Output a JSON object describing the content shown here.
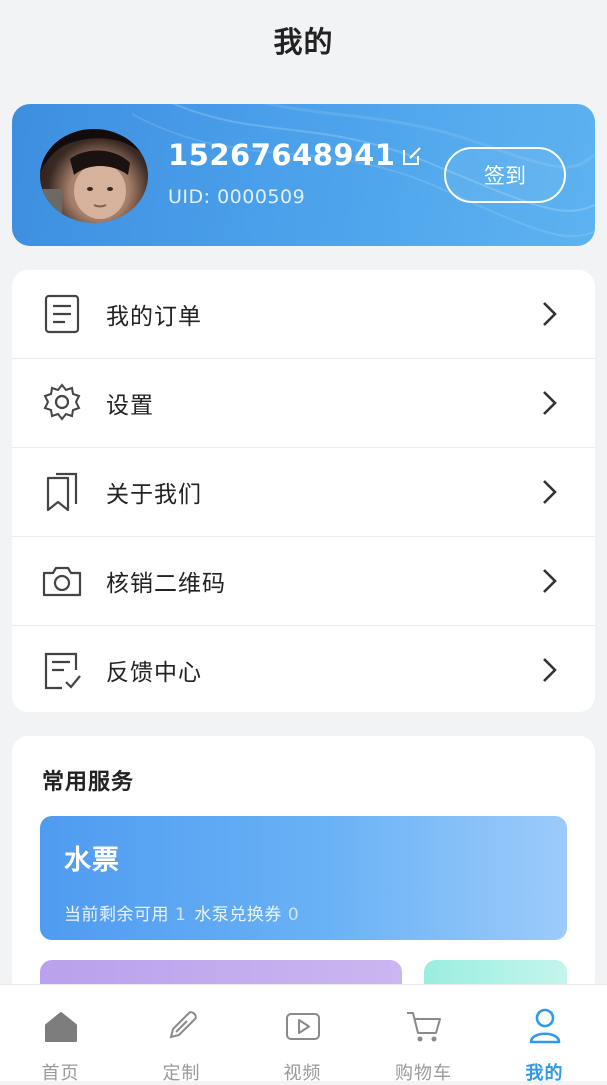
{
  "header": {
    "title": "我的"
  },
  "profile": {
    "phone": "15267648941",
    "uid": "UID: 0000509",
    "signin_label": "签到"
  },
  "menu": {
    "items": [
      {
        "label": "我的订单",
        "icon": "order-list-icon"
      },
      {
        "label": "设置",
        "icon": "gear-icon"
      },
      {
        "label": "关于我们",
        "icon": "bookmark-icon"
      },
      {
        "label": "核销二维码",
        "icon": "camera-icon"
      },
      {
        "label": "反馈中心",
        "icon": "feedback-icon"
      }
    ]
  },
  "services": {
    "title": "常用服务",
    "water_ticket": {
      "title": "水票",
      "remaining_label": "当前剩余可用",
      "remaining_value": "1",
      "pump_label": "水泵兑换券",
      "pump_value": "0"
    }
  },
  "tabbar": {
    "items": [
      {
        "label": "首页",
        "icon": "home-icon"
      },
      {
        "label": "定制",
        "icon": "pen-icon"
      },
      {
        "label": "视频",
        "icon": "video-icon"
      },
      {
        "label": "购物车",
        "icon": "cart-icon"
      },
      {
        "label": "我的",
        "icon": "user-icon",
        "active": true
      }
    ]
  },
  "colors": {
    "accent": "#2f9be8",
    "profile_card": "#4aa0ea",
    "inactive_tab": "#9a9a9a"
  }
}
